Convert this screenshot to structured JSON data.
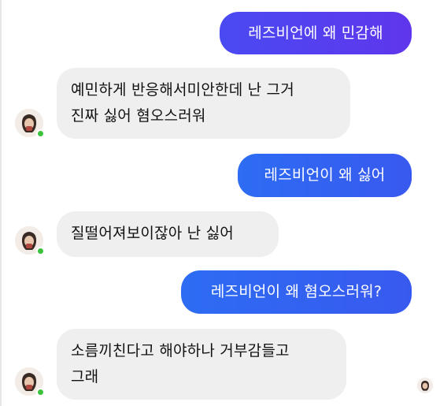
{
  "messages": [
    {
      "direction": "sent",
      "text": "레즈비언에 왜 민감해"
    },
    {
      "direction": "received",
      "lines": [
        "예민하게 반응해서미안한데 난 그거",
        "진짜 싫어 혐오스러워"
      ]
    },
    {
      "direction": "sent",
      "text": "레즈비언이 왜 싫어"
    },
    {
      "direction": "received",
      "lines": [
        "질떨어져보이잖아 난 싫어"
      ]
    },
    {
      "direction": "sent",
      "text": "레즈비언이 왜 혐오스러워?"
    },
    {
      "direction": "received",
      "lines": [
        "소름끼친다고 해야하나 거부감들고",
        "그래"
      ]
    }
  ],
  "contact": {
    "online": true,
    "avatar_icon": "profile-photo-avatar"
  },
  "colors": {
    "sent_purple": "#5a3cee",
    "sent_blue": "#3163f1",
    "received_bg": "#efefef",
    "online": "#3cc13b"
  }
}
